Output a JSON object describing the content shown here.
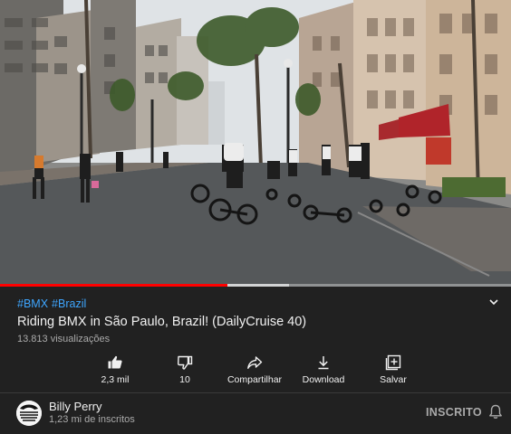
{
  "player": {
    "progress_fraction": 0.445,
    "buffered_fraction": 0.565,
    "colors": {
      "played": "#ff0000",
      "buffered": "#d9d9d9"
    }
  },
  "video": {
    "hashtags": [
      "#BMX",
      "#Brazil"
    ],
    "title": "Riding BMX in São Paulo, Brazil! (DailyCruise 40)",
    "views": "13.813 visualizações"
  },
  "actions": {
    "like": {
      "label": "2,3 mil",
      "icon": "thumbs-up-icon"
    },
    "dislike": {
      "label": "10",
      "icon": "thumbs-down-icon"
    },
    "share": {
      "label": "Compartilhar",
      "icon": "share-icon"
    },
    "download": {
      "label": "Download",
      "icon": "download-icon"
    },
    "save": {
      "label": "Salvar",
      "icon": "add-to-playlist-icon"
    }
  },
  "channel": {
    "name": "Billy Perry",
    "subscribers": "1,23 mi de inscritos",
    "subscribe_label": "INSCRITO",
    "bell_icon": "bell-icon"
  },
  "colors": {
    "background": "#212121",
    "hashtag": "#3ea6ff",
    "secondary_text": "#aaaaaa"
  }
}
